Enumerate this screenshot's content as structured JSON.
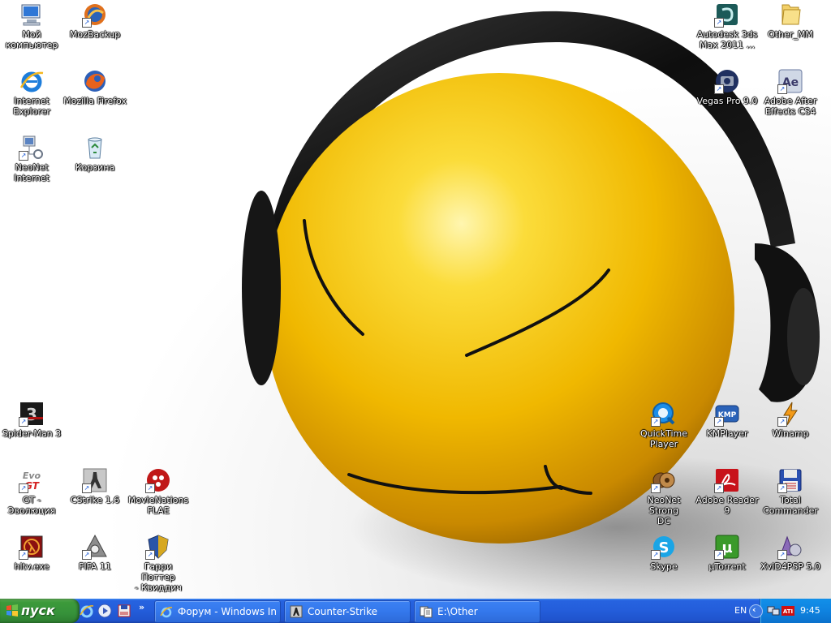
{
  "desktop_icons": {
    "my_computer": "Мой\nкомпьютер",
    "mozbackup": "MozBackup",
    "internet_explorer": "Internet\nExplorer",
    "mozilla_firefox": "Mozilla Firefox",
    "neonet_internet": "NeoNet\nInternet",
    "recycle_bin": "Корзина",
    "autodesk_3ds": "Autodesk 3ds\nMax 2011 ...",
    "other_mm": "Other_MM",
    "vegas_pro": "Vegas Pro 9.0",
    "after_effects": "Adobe After\nEffects CS4",
    "spiderman": "Spider-Man 3",
    "gt_evolution": "GT - Эволюция",
    "cstrike": "CStrike 1.6",
    "movienations": "MovieNations\nFLAE",
    "hltv": "hltv.exe",
    "fifa": "FIFA 11",
    "harry_potter": "Гарри Поттер\n- Квиддич",
    "quicktime": "QuickTime\nPlayer",
    "kmplayer": "KMPlayer",
    "winamp": "Winamp",
    "neonet_dc": "NeoNet Strong\nDC",
    "adobe_reader": "Adobe Reader\n9",
    "total_commander": "Total\nCommander",
    "skype": "Skype",
    "utorrent": "µTorrent",
    "xvid4psp": "XviD4PSP 5.0"
  },
  "taskbar": {
    "start_label": "пуск",
    "quick_launch_more": "»",
    "tasks": [
      {
        "label": "Форум - Windows Int..."
      },
      {
        "label": "Counter-Strike"
      },
      {
        "label": "E:\\Other"
      }
    ],
    "language": "EN",
    "tray_toggle": "‹",
    "clock": "9:45"
  },
  "colors": {
    "taskbar_blue": "#245edb",
    "start_green": "#3c9a3a",
    "tray_blue": "#0f83e0",
    "smiley_yellow": "#f5c400"
  }
}
